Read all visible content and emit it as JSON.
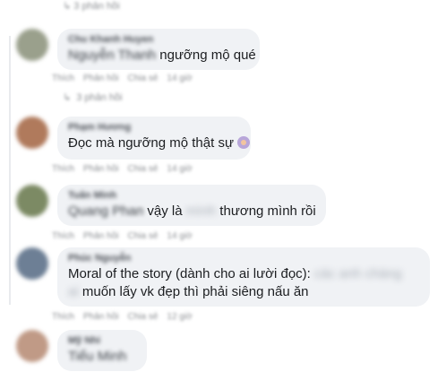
{
  "top_reply": "↳ 3 phản hồi",
  "comments": [
    {
      "name": "Chu Khanh Huyen",
      "mention": "Nguyễn Thanh",
      "text": " ngưỡng mộ qué",
      "actions": [
        "Thích",
        "Phản hồi",
        "Chia sẻ",
        "14 giờ"
      ],
      "reply": "3 phản hồi",
      "avatar_color": "#9aa08c"
    },
    {
      "name": "Phạm Hương",
      "text": "Đọc mà ngưỡng mộ thật sự",
      "actions": [
        "Thích",
        "Phản hồi",
        "Chia sẻ",
        "14 giờ"
      ],
      "avatar_color": "#b07a5c"
    },
    {
      "name": "Tuấn Minh",
      "mention": "Quang Phan",
      "text_a": " vậy là ",
      "hidden": "mình",
      "text_b": " thương mình rồi",
      "actions": [
        "Thích",
        "Phản hồi",
        "Chia sẻ",
        "14 giờ"
      ],
      "avatar_color": "#7c8a64"
    },
    {
      "name": "Phúc Nguyễn",
      "line1": "Moral of the story (dành cho ai lười đọc):",
      "hidden1": "các anh chàng",
      "hidden2": "ai",
      "line2": " muốn lấy vk đẹp thì phải siêng nấu ăn",
      "actions": [
        "Thích",
        "Phản hồi",
        "Chia sẻ",
        "12 giờ"
      ],
      "avatar_color": "#6d7f95"
    },
    {
      "name": "Mỹ Nhi",
      "text": "Tiểu Minh",
      "avatar_color": "#c09a86"
    }
  ]
}
